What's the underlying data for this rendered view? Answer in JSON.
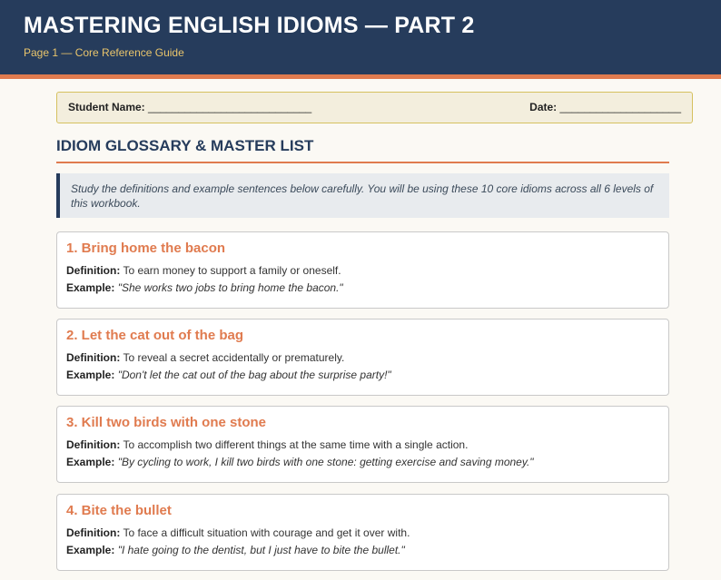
{
  "header": {
    "title": "MASTERING ENGLISH IDIOMS — PART 2",
    "subtitle": "Page 1 — Core Reference Guide"
  },
  "student_bar": {
    "name_label": "Student Name:",
    "name_blank": " ___________________________",
    "date_label": "Date:",
    "date_blank": " ____________________"
  },
  "section": {
    "title": "IDIOM GLOSSARY & MASTER LIST",
    "instructions": "Study the definitions and example sentences below carefully. You will be using these 10 core idioms across all 6 levels of this workbook."
  },
  "labels": {
    "definition": "Definition:",
    "example": "Example:"
  },
  "idioms": [
    {
      "title": "1. Bring home the bacon",
      "definition": "To earn money to support a family or oneself.",
      "example": "\"She works two jobs to bring home the bacon.\""
    },
    {
      "title": "2. Let the cat out of the bag",
      "definition": "To reveal a secret accidentally or prematurely.",
      "example": "\"Don't let the cat out of the bag about the surprise party!\""
    },
    {
      "title": "3. Kill two birds with one stone",
      "definition": "To accomplish two different things at the same time with a single action.",
      "example": "\"By cycling to work, I kill two birds with one stone: getting exercise and saving money.\""
    },
    {
      "title": "4. Bite the bullet",
      "definition": "To face a difficult situation with courage and get it over with.",
      "example": "\"I hate going to the dentist, but I just have to bite the bullet.\""
    }
  ],
  "colors": {
    "header_bg": "#263c5c",
    "accent": "#e07b4f",
    "subtitle": "#e9c56c"
  }
}
